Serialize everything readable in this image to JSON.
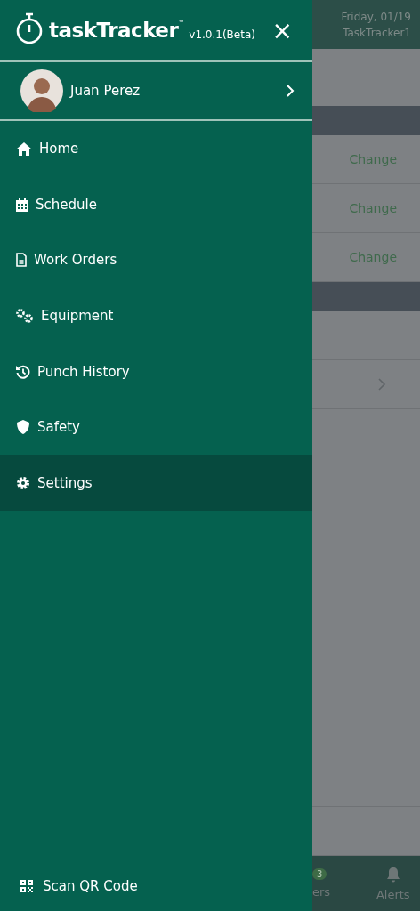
{
  "drawer": {
    "app_name": "taskTracker",
    "trademark": "™",
    "version": "v1.0.1(Beta)",
    "close": "×",
    "user": {
      "name": "Juan Perez"
    },
    "items": [
      {
        "label": "Home",
        "kind": "home",
        "selected": false
      },
      {
        "label": "Schedule",
        "kind": "calendar",
        "selected": false
      },
      {
        "label": "Work Orders",
        "kind": "document",
        "selected": false
      },
      {
        "label": "Equipment",
        "kind": "gears",
        "selected": false
      },
      {
        "label": "Punch History",
        "kind": "history",
        "selected": false
      },
      {
        "label": "Safety",
        "kind": "shield",
        "selected": false
      },
      {
        "label": "Settings",
        "kind": "gear",
        "selected": true
      }
    ],
    "footer": {
      "label": "Scan QR Code"
    }
  },
  "background": {
    "date": "Friday, 01/19",
    "account": "TaskTracker1",
    "rows": [
      {
        "kind": "header"
      },
      {
        "kind": "action",
        "text": "Change"
      },
      {
        "kind": "action",
        "text": "Change"
      },
      {
        "kind": "action",
        "text": "Change"
      },
      {
        "kind": "header"
      },
      {
        "kind": "blank"
      },
      {
        "kind": "link"
      }
    ],
    "nav": [
      {
        "label": "ers",
        "badge": "3"
      },
      {
        "label": "Alerts"
      }
    ]
  }
}
